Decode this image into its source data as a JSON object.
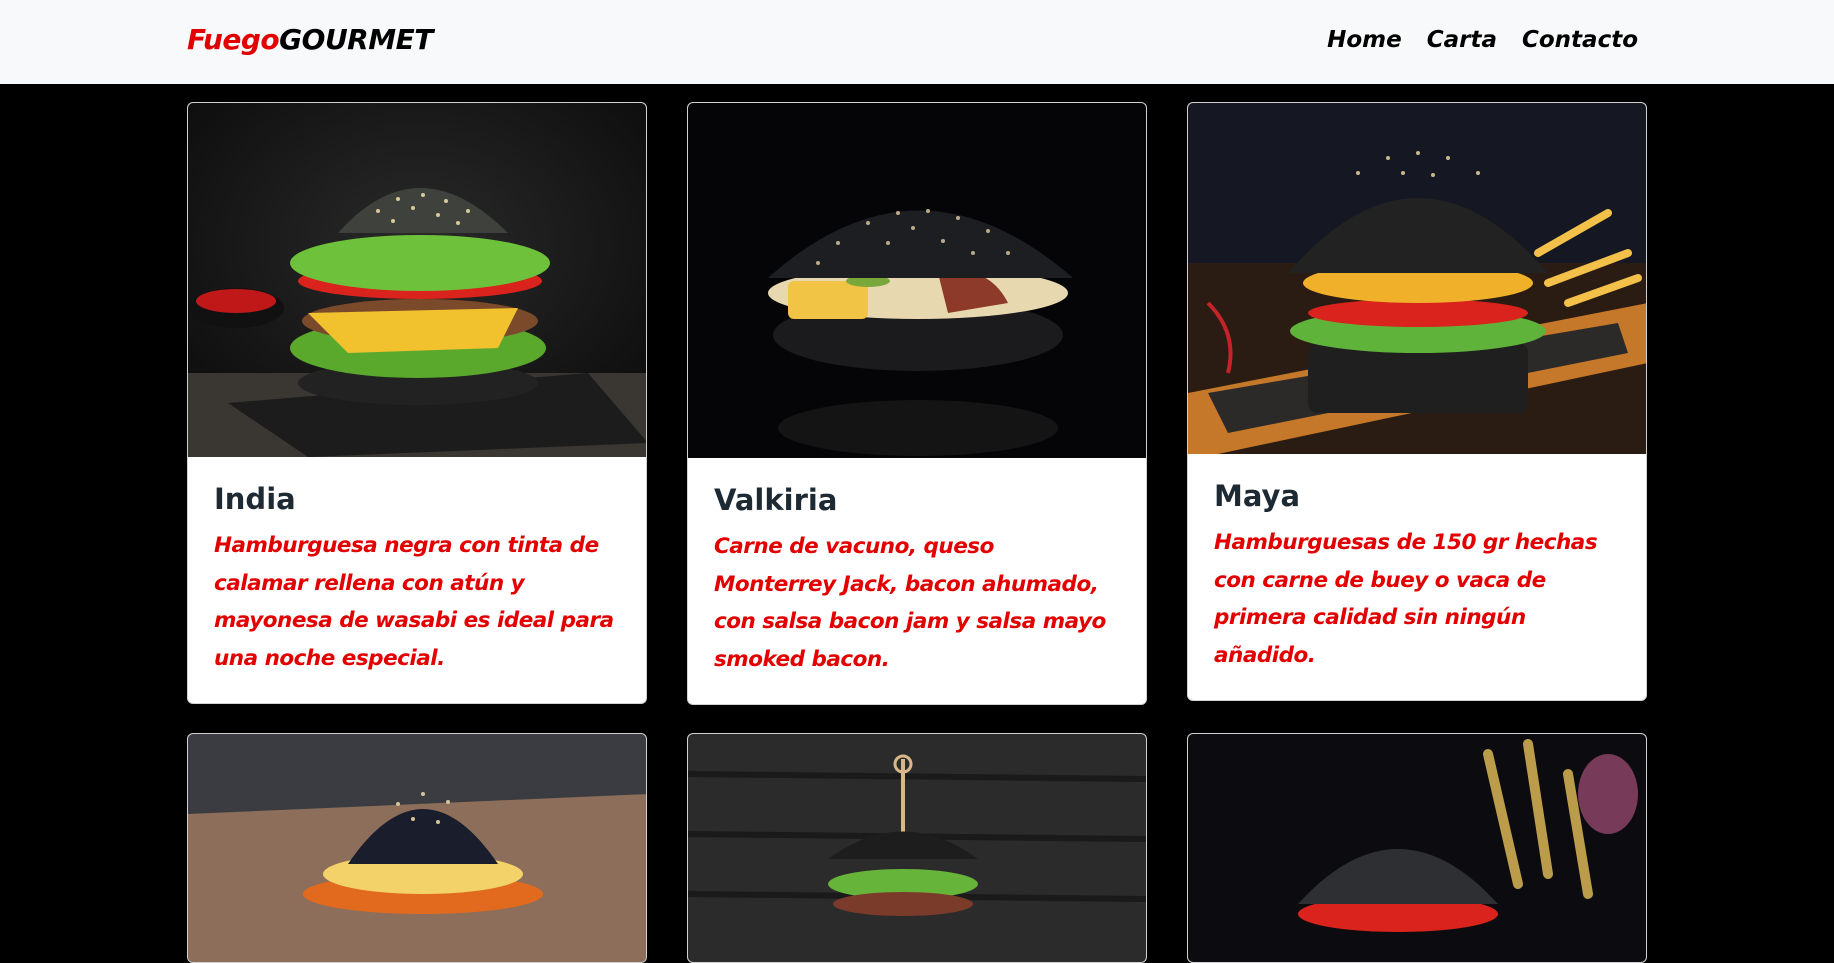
{
  "navbar": {
    "brand_part1": "Fuego",
    "brand_part2": "GOURMET",
    "links": [
      "Home",
      "Carta",
      "Contacto"
    ]
  },
  "cards": [
    {
      "title": "India",
      "text": "Hamburguesa negra con tinta de calamar rellena con atún y mayonesa de wasabi es ideal para una noche especial."
    },
    {
      "title": "Valkiria",
      "text": "Carne de vacuno, queso Monterrey Jack, bacon ahumado, con salsa bacon jam y salsa mayo smoked bacon."
    },
    {
      "title": "Maya",
      "text": "Hamburguesas de 150 gr hechas con carne de buey o vaca de primera calidad sin ningún añadido."
    },
    {
      "title": "",
      "text": ""
    },
    {
      "title": "",
      "text": ""
    },
    {
      "title": "",
      "text": ""
    }
  ],
  "colors": {
    "accent": "#e20000",
    "navbar_bg": "#f8f9fa",
    "page_bg": "#000000",
    "title": "#1e2a33"
  }
}
